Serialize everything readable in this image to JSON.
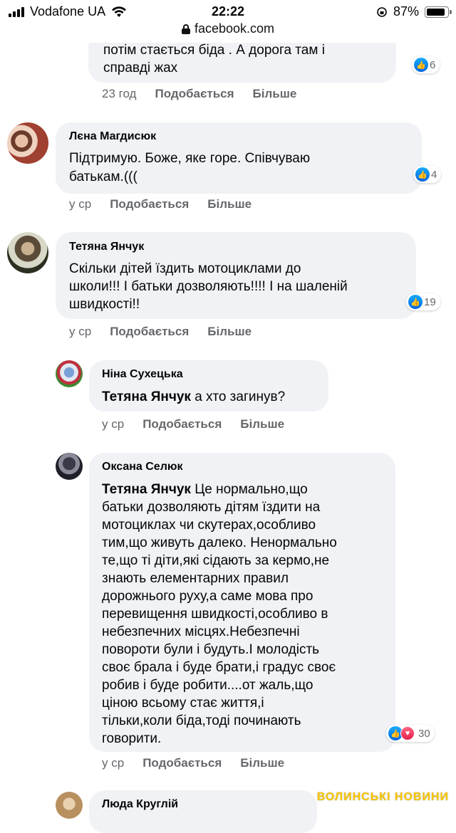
{
  "status_bar": {
    "carrier": "Vodafone UA",
    "time": "22:22",
    "battery": "87%",
    "url": "facebook.com"
  },
  "comments": [
    {
      "text_lines": [
        "потім стається біда . А дорога там і",
        "справді жах"
      ],
      "reactions": "6",
      "time": "23 год",
      "like": "Подобається",
      "more": "Більше"
    },
    {
      "author": "Лєна Магдисюк",
      "text_lines": [
        "Підтримую. Боже, яке горе. Співчуваю",
        "батькам.((("
      ],
      "reactions": "4",
      "time": "у ср",
      "like": "Подобається",
      "more": "Більше"
    },
    {
      "author": "Тетяна Янчук",
      "text_lines": [
        "Скільки дітей їздить мотоциклами до",
        "школи!!! І батьки дозволяють!!!! І на шаленій",
        "швидкості!!"
      ],
      "reactions": "19",
      "time": "у ср",
      "like": "Подобається",
      "more": "Більше"
    },
    {
      "author": "Ніна Сухецька",
      "mention": "Тетяна Янчук",
      "text_first": " а хто загинув?",
      "time": "у ср",
      "like": "Подобається",
      "more": "Більше"
    },
    {
      "author": "Оксана Селюк",
      "mention": "Тетяна Янчук",
      "text_first": " Це нормально,що",
      "text_lines": [
        "батьки дозволяють дітям їздити на",
        "мотоциклах чи скутерах,особливо",
        "тим,що живуть далеко. Ненормально",
        "те,що ті діти,які сідають за кермо,не",
        "знають елементарних правил",
        "дорожнього руху,а саме мова про",
        "перевищення швидкості,особливо в",
        "небезпечних місцях.Небезпечні",
        "повороти були і будуть.І молодість",
        "своє брала і буде брати,і градус своє",
        "робив і буде робити....от жаль,що",
        "ціною всьому стає життя,і",
        "тільки,коли біда,тоді починають",
        "говорити."
      ],
      "reactions": "30",
      "time": "у ср",
      "like": "Подобається",
      "more": "Більше"
    },
    {
      "author": "Люда Круглій"
    }
  ],
  "watermark": "ВОЛИНСЬКІ НОВИНИ",
  "icons": [
    "signal-icon",
    "wifi-icon",
    "lock-icon",
    "battery-icon",
    "like-icon",
    "love-icon"
  ]
}
